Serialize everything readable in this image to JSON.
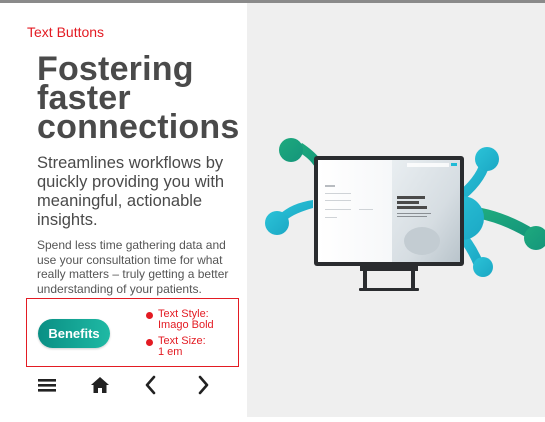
{
  "caption": "Text Buttons",
  "hero": {
    "title_lines": [
      "Fostering",
      "faster",
      "connections"
    ],
    "subtitle": "Streamlines workflows by quickly providing you with meaningful, actionable insights.",
    "body": "Spend less time gathering data and use your consultation time for what really matters – truly getting a better understanding of your patients."
  },
  "button": {
    "label": "Benefits"
  },
  "specs": {
    "style_label": "Text Style:",
    "style_value": "Imago Bold",
    "size_label": "Text Size:",
    "size_value": "1 em"
  },
  "nav": {
    "menu_icon": "hamburger-menu-icon",
    "home_icon": "home-icon",
    "back_icon": "chevron-left-icon",
    "forward_icon": "chevron-right-icon"
  },
  "colors": {
    "caption": "#e31b23",
    "button_start": "#0a8f84",
    "button_end": "#1fb9a4",
    "title": "#4a4a4a",
    "panel_bg": "#efefef",
    "accent_blue": "#1fbad6",
    "accent_green": "#1ea37e"
  }
}
